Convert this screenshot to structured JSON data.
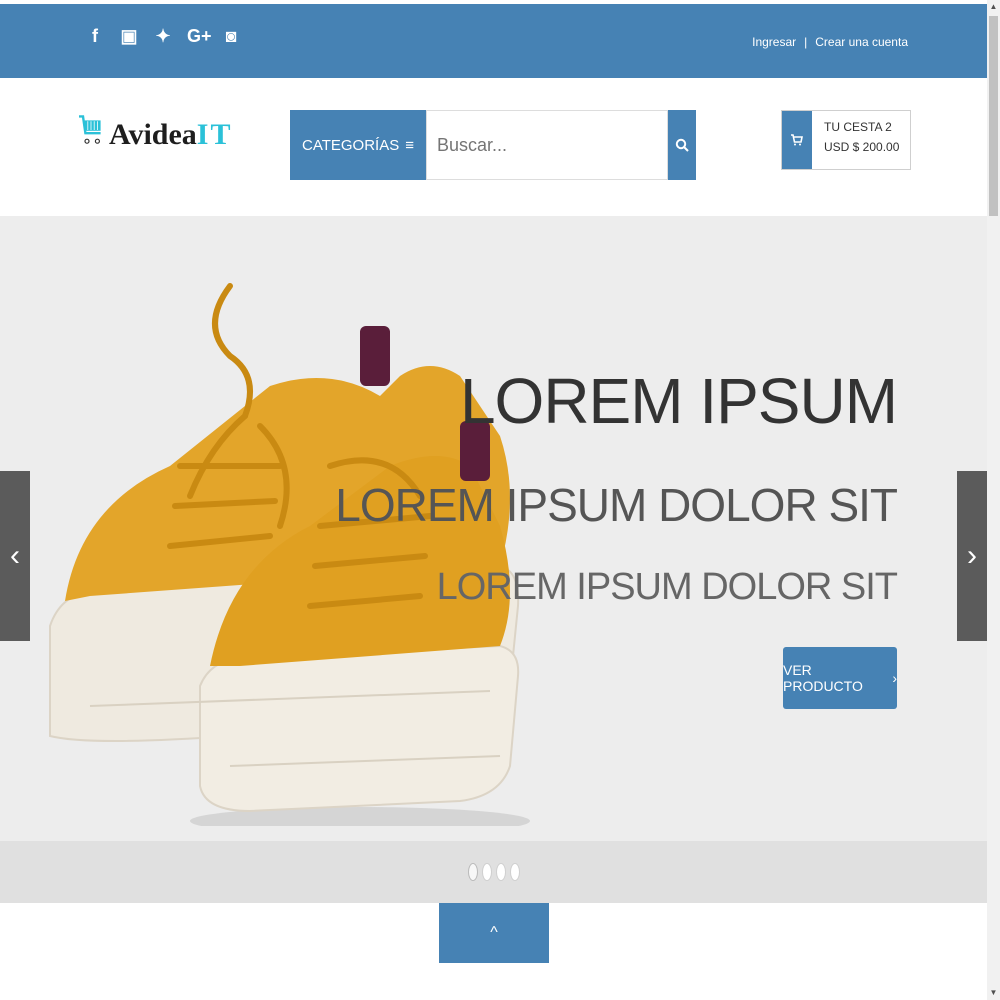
{
  "topbar": {
    "social_icons": [
      {
        "name": "facebook-icon",
        "glyph": "f"
      },
      {
        "name": "youtube-icon",
        "glyph": "▣"
      },
      {
        "name": "twitter-icon",
        "glyph": "🐦"
      },
      {
        "name": "google-plus-icon",
        "glyph": "G+"
      },
      {
        "name": "instagram-icon",
        "glyph": "◙"
      }
    ],
    "login": "Ingresar",
    "separator": "|",
    "register": "Crear una cuenta"
  },
  "header": {
    "logo": {
      "prefix": "A",
      "middle": "videa",
      "suffix": "IT"
    },
    "categories_label": "CATEGORÍAS",
    "menu_glyph": "≡",
    "search_placeholder": "Buscar...",
    "search_glyph": "🔍",
    "cart": {
      "line1": "TU CESTA 2",
      "line2": "USD $ 200.00",
      "glyph": "🛒"
    }
  },
  "hero": {
    "title": "LOREM IPSUM",
    "subtitle1": "LOREM IPSUM DOLOR SIT",
    "subtitle2": "LOREM IPSUM DOLOR SIT",
    "button_label": "VER PRODUCTO",
    "button_chevron": "›",
    "prev_glyph": "‹",
    "next_glyph": "›",
    "slide_count": 4,
    "active_slide": 1
  },
  "scroll_top_glyph": "^",
  "colors": {
    "accent": "#4682b4",
    "hero_bg": "#ededed",
    "logo_cyan": "#2bc1d8",
    "shoe": "#e3a52a"
  }
}
